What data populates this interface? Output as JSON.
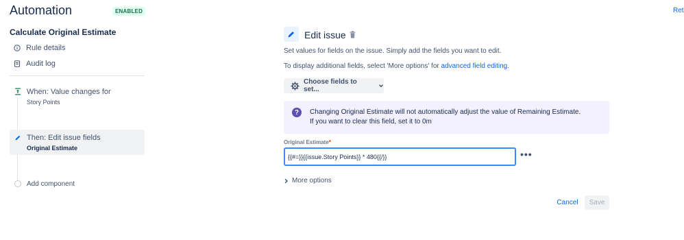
{
  "header": {
    "title": "Automation",
    "status_badge": "ENABLED",
    "return_link": "Retu"
  },
  "sidebar": {
    "rule_name": "Calculate Original Estimate",
    "links": [
      {
        "label": "Rule details",
        "icon": "info-icon"
      },
      {
        "label": "Audit log",
        "icon": "document-icon"
      }
    ],
    "trigger": {
      "title": "When: Value changes for",
      "subtitle": "Story Points",
      "icon": "trigger-icon"
    },
    "action": {
      "title": "Then: Edit issue fields",
      "subtitle": "Original Estimate",
      "icon": "pencil-icon"
    },
    "add_component": "Add component"
  },
  "main": {
    "title": "Edit issue",
    "description": "Set values for fields on the issue. Simply add the fields you want to edit.",
    "description2_prefix": "To display additional fields, select 'More options' for ",
    "description2_link": "advanced field editing",
    "description2_suffix": ".",
    "choose_fields_label": "Choose fields to set...",
    "info": {
      "line1": "Changing Original Estimate will not automatically adjust the value of Remaining Estimate.",
      "line2": "If you want to clear this field, set it to 0m"
    },
    "field": {
      "label": "Original Estimate",
      "required_mark": "*",
      "value": "{{#=}}{{issue.Story Points}} * 480{{/}}"
    },
    "more_options_label": "More options",
    "cancel_label": "Cancel",
    "save_label": "Save"
  },
  "colors": {
    "accent": "#0c66e4",
    "badge_bg": "#dcfff1",
    "badge_text": "#216e4e",
    "info_bg": "#f3f0ff",
    "info_icon": "#5e4db2"
  }
}
